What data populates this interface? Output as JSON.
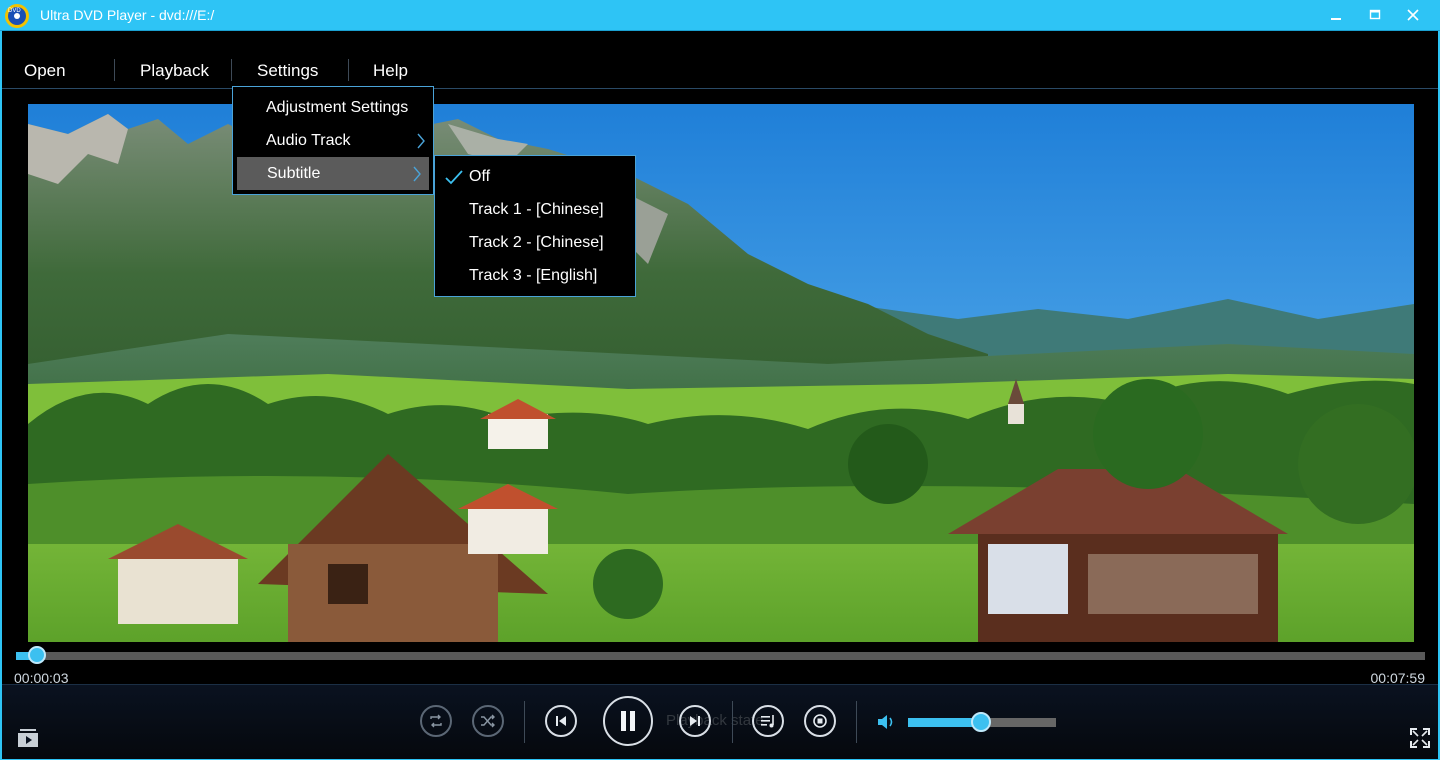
{
  "window": {
    "title": "Ultra DVD Player - dvd:///E:/",
    "accent_color": "#2ec4f5",
    "icons": [
      "app-logo-icon",
      "minimize-icon",
      "maximize-icon",
      "close-icon"
    ]
  },
  "menu": {
    "items": [
      "Open",
      "Playback",
      "Settings",
      "Help"
    ]
  },
  "settings_menu": {
    "items": [
      {
        "label": "Adjustment Settings",
        "has_submenu": false
      },
      {
        "label": "Audio Track",
        "has_submenu": true
      },
      {
        "label": "Subtitle",
        "has_submenu": true,
        "highlighted": true
      }
    ]
  },
  "subtitle_menu": {
    "items": [
      {
        "label": "Off",
        "checked": true
      },
      {
        "label": "Track 1 - [Chinese]",
        "checked": false
      },
      {
        "label": "Track 2 - [Chinese]",
        "checked": false
      },
      {
        "label": "Track 3 - [English]",
        "checked": false
      }
    ]
  },
  "playback": {
    "current_time": "00:00:03",
    "total_time": "00:07:59",
    "progress_fraction": 0.015,
    "volume_fraction": 0.49,
    "obscured_text": "Playback state"
  },
  "controls": {
    "icons": [
      "playlist-icon",
      "repeat-icon",
      "shuffle-icon",
      "previous-icon",
      "pause-icon",
      "next-icon",
      "music-list-icon",
      "stop-icon",
      "volume-icon",
      "fullscreen-icon"
    ]
  }
}
